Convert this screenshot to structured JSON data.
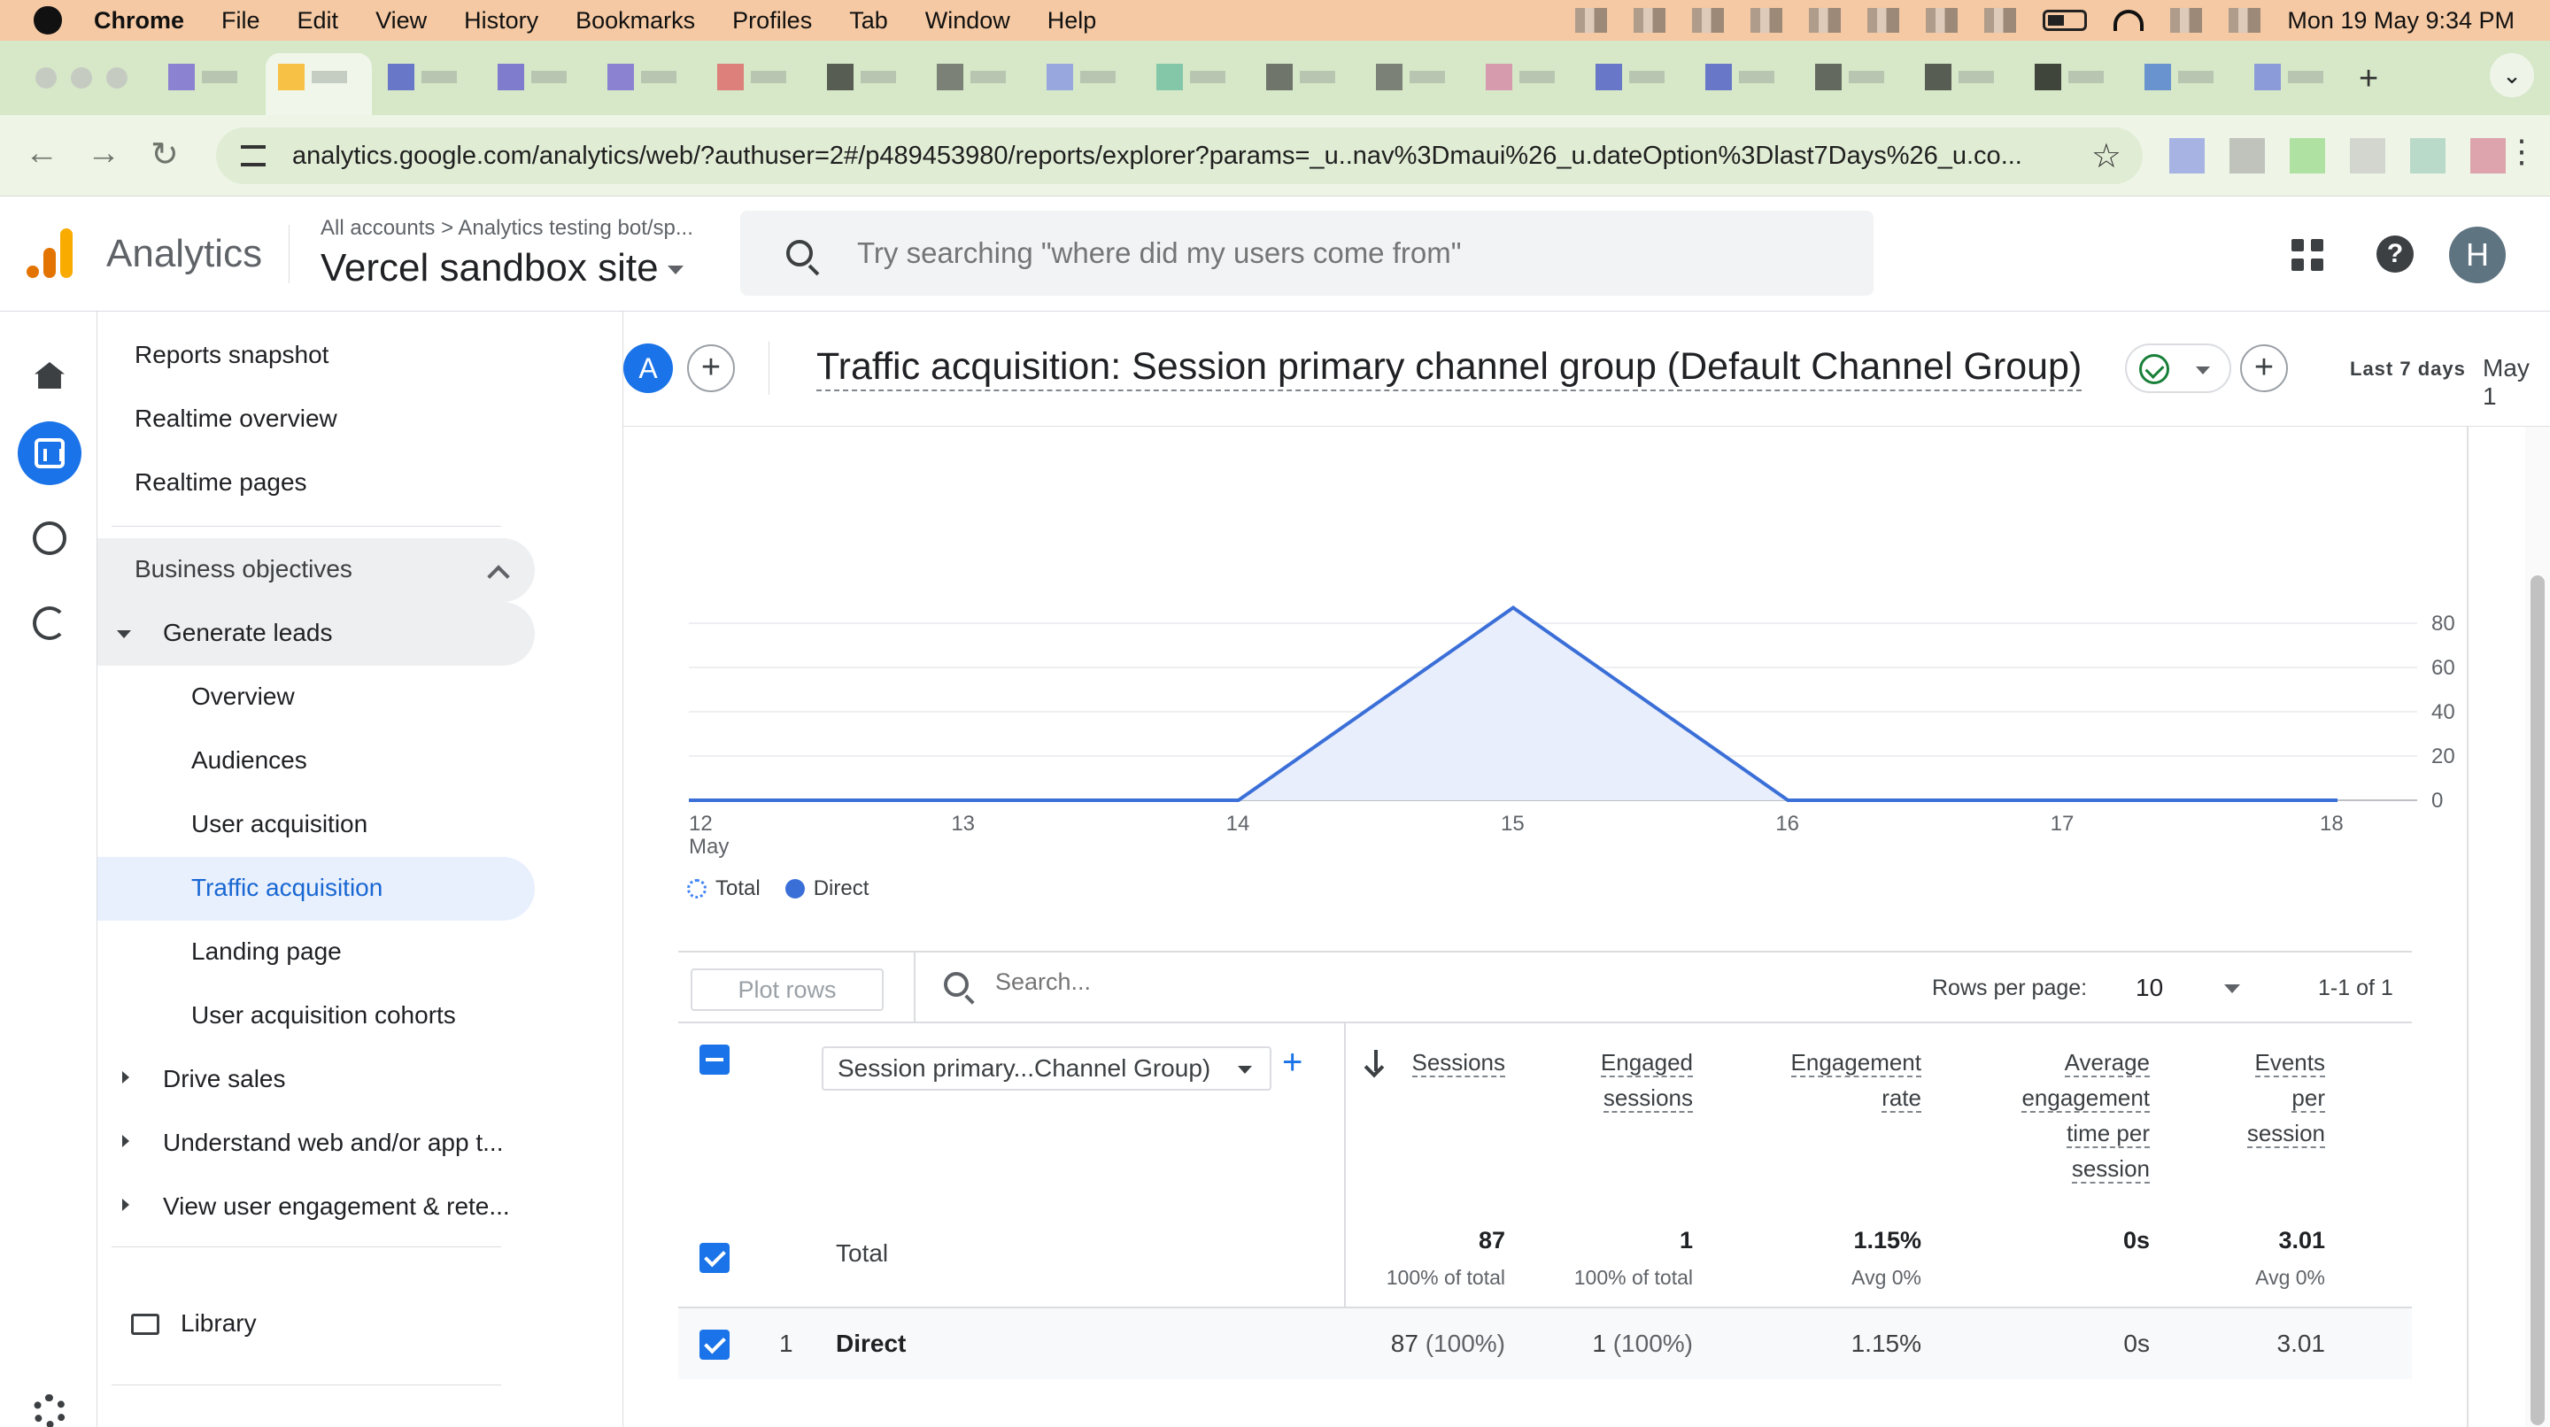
{
  "menubar": {
    "app": "Chrome",
    "items": [
      "File",
      "Edit",
      "View",
      "History",
      "Bookmarks",
      "Profiles",
      "Tab",
      "Window",
      "Help"
    ],
    "clock": "Mon 19 May  9:34 PM"
  },
  "browser": {
    "url": "analytics.google.com/analytics/web/?authuser=2#/p489453980/reports/explorer?params=_u..nav%3Dmaui%26_u.dateOption%3Dlast7Days%26_u.co...",
    "new_tab": "+"
  },
  "ga": {
    "product": "Analytics",
    "breadcrumb": "All accounts  >  Analytics testing bot/sp...",
    "property": "Vercel sandbox site",
    "search_placeholder": "Try searching \"where did my users come from\"",
    "help": "?",
    "avatar": "H"
  },
  "sidebar": {
    "items": [
      {
        "label": "Reports snapshot"
      },
      {
        "label": "Realtime overview"
      },
      {
        "label": "Realtime pages"
      },
      {
        "label": "Business objectives"
      },
      {
        "label": "Generate leads"
      },
      {
        "label": "Overview"
      },
      {
        "label": "Audiences"
      },
      {
        "label": "User acquisition"
      },
      {
        "label": "Traffic acquisition"
      },
      {
        "label": "Landing page"
      },
      {
        "label": "User acquisition cohorts"
      },
      {
        "label": "Drive sales"
      },
      {
        "label": "Understand web and/or app t..."
      },
      {
        "label": "View user engagement & rete..."
      },
      {
        "label": "Library"
      }
    ]
  },
  "report": {
    "compare_avatar": "A",
    "title": "Traffic acquisition: Session primary channel group (Default Channel Group)",
    "date_label": "Last 7 days",
    "date_value": "May 1"
  },
  "chart_data": {
    "type": "line",
    "x": [
      "12",
      "13",
      "14",
      "15",
      "16",
      "17",
      "18"
    ],
    "x_sublabel_first": "May",
    "series": [
      {
        "name": "Direct",
        "values": [
          0,
          0,
          0,
          87,
          0,
          0,
          0
        ]
      }
    ],
    "legend": [
      "Total",
      "Direct"
    ],
    "ylim": [
      0,
      80
    ],
    "yticks": [
      0,
      20,
      40,
      60,
      80
    ],
    "y_axis_side": "right",
    "grid": true,
    "colors": {
      "line": "#3b6fd8",
      "fill": "#e8eefb"
    }
  },
  "table": {
    "plot_rows": "Plot rows",
    "search_placeholder": "Search...",
    "rows_per_page_label": "Rows per page:",
    "rows_per_page": "10",
    "pagination": "1-1 of 1",
    "dimension": "Session primary...Channel Group)",
    "headers": {
      "sessions": "Sessions",
      "engaged_1": "Engaged",
      "engaged_2": "sessions",
      "rate_1": "Engagement",
      "rate_2": "rate",
      "avg_1": "Average",
      "avg_2": "engagement",
      "avg_3": "time per",
      "avg_4": "session",
      "epс_1": "Events",
      "eps_2": "per",
      "eps_3": "session"
    },
    "total": {
      "label": "Total",
      "sessions": "87",
      "sessions_sub": "100% of total",
      "engaged": "1",
      "engaged_sub": "100% of total",
      "rate": "1.15%",
      "rate_sub": "Avg 0%",
      "avg_time": "0s",
      "events": "3.01",
      "events_sub": "Avg 0%"
    },
    "rows": [
      {
        "index": "1",
        "name": "Direct",
        "sessions": "87",
        "sessions_pct": "(100%)",
        "engaged": "1",
        "engaged_pct": "(100%)",
        "rate": "1.15%",
        "avg_time": "0s",
        "events": "3.01"
      }
    ]
  }
}
